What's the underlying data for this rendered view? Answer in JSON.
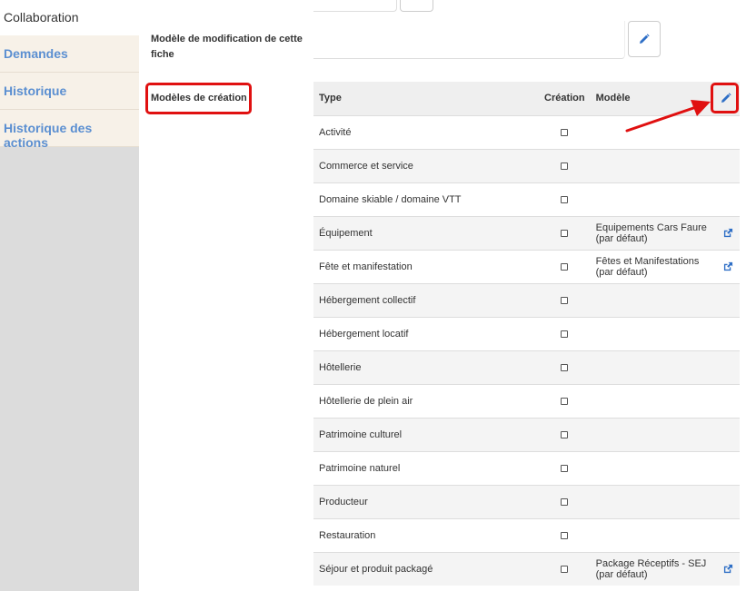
{
  "sidebar": {
    "title": "Collaboration",
    "items": [
      {
        "label": "Demandes"
      },
      {
        "label": "Historique"
      },
      {
        "label": "Historique des actions"
      }
    ]
  },
  "form": {
    "modif_label": "Modèle de modification de cette fiche",
    "creation_label": "Modèles de création"
  },
  "table": {
    "headers": {
      "type": "Type",
      "creation": "Création",
      "model": "Modèle"
    },
    "rows": [
      {
        "type": "Activité",
        "model": ""
      },
      {
        "type": "Commerce et service",
        "model": ""
      },
      {
        "type": "Domaine skiable / domaine VTT",
        "model": ""
      },
      {
        "type": "Équipement",
        "model": "Equipements Cars Faure (par défaut)"
      },
      {
        "type": "Fête et manifestation",
        "model": "Fêtes et Manifestations (par défaut)"
      },
      {
        "type": "Hébergement collectif",
        "model": ""
      },
      {
        "type": "Hébergement locatif",
        "model": ""
      },
      {
        "type": "Hôtellerie",
        "model": ""
      },
      {
        "type": "Hôtellerie de plein air",
        "model": ""
      },
      {
        "type": "Patrimoine culturel",
        "model": ""
      },
      {
        "type": "Patrimoine naturel",
        "model": ""
      },
      {
        "type": "Producteur",
        "model": ""
      },
      {
        "type": "Restauration",
        "model": ""
      },
      {
        "type": "Séjour et produit packagé",
        "model": "Package Réceptifs - SEJ (par défaut)"
      }
    ]
  },
  "colors": {
    "accent": "#5b8fd1",
    "highlight": "#e01010",
    "icon": "#2f6fc6"
  }
}
